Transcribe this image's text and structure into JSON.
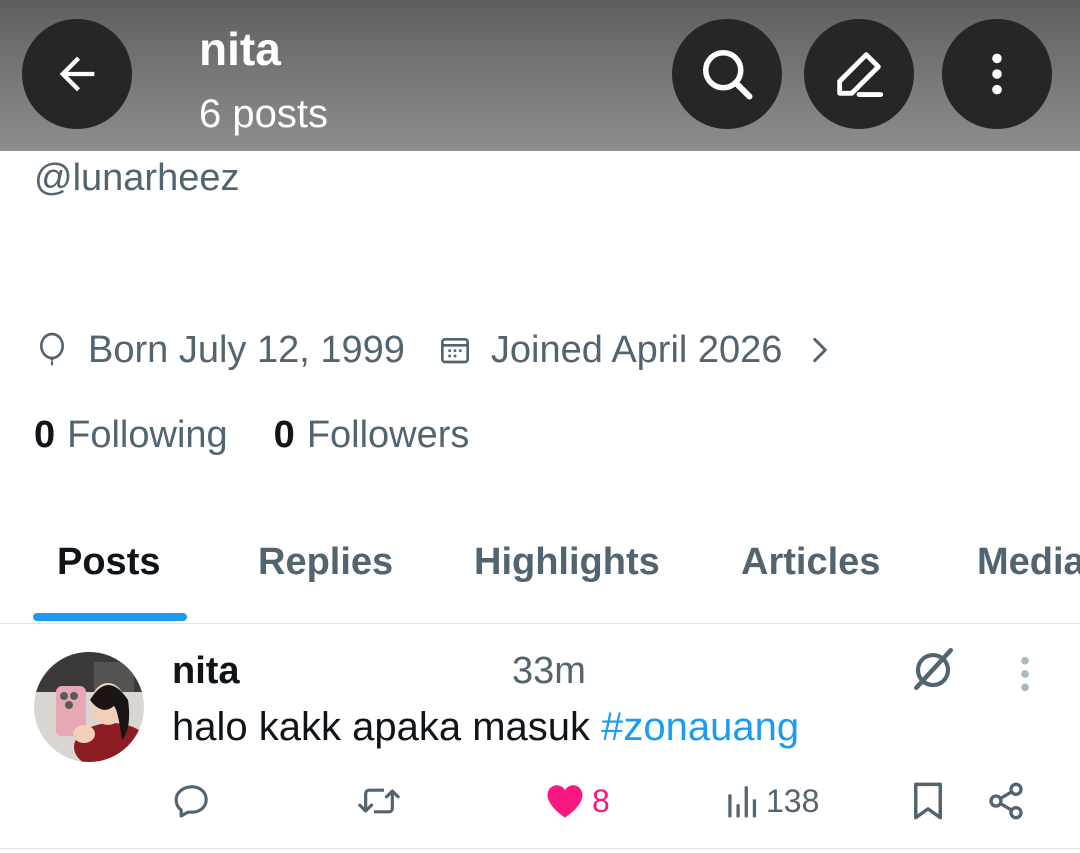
{
  "header": {
    "title": "nita",
    "subtitle": "6 posts",
    "buttons": [
      "back-arrow-icon",
      "search-icon",
      "compose-icon",
      "more-vertical-icon"
    ]
  },
  "profile": {
    "handle": "@lunarheez",
    "born": "Born July 12, 1999",
    "joined": "Joined April 2026",
    "following_count": "0",
    "following_label": "Following",
    "followers_count": "0",
    "followers_label": "Followers"
  },
  "tabs": [
    {
      "label": "Posts",
      "active": true
    },
    {
      "label": "Replies",
      "active": false
    },
    {
      "label": "Highlights",
      "active": false
    },
    {
      "label": "Articles",
      "active": false
    },
    {
      "label": "Media",
      "active": false
    }
  ],
  "post": {
    "author": "nita",
    "time": "33m",
    "text": "halo kakk apaka masuk ",
    "hashtag": "#zonauang",
    "likes": "8",
    "views": "138",
    "liked": true
  },
  "colors": {
    "accent": "#1d9bf0",
    "like": "#f91880",
    "secondary_text": "#536471"
  }
}
